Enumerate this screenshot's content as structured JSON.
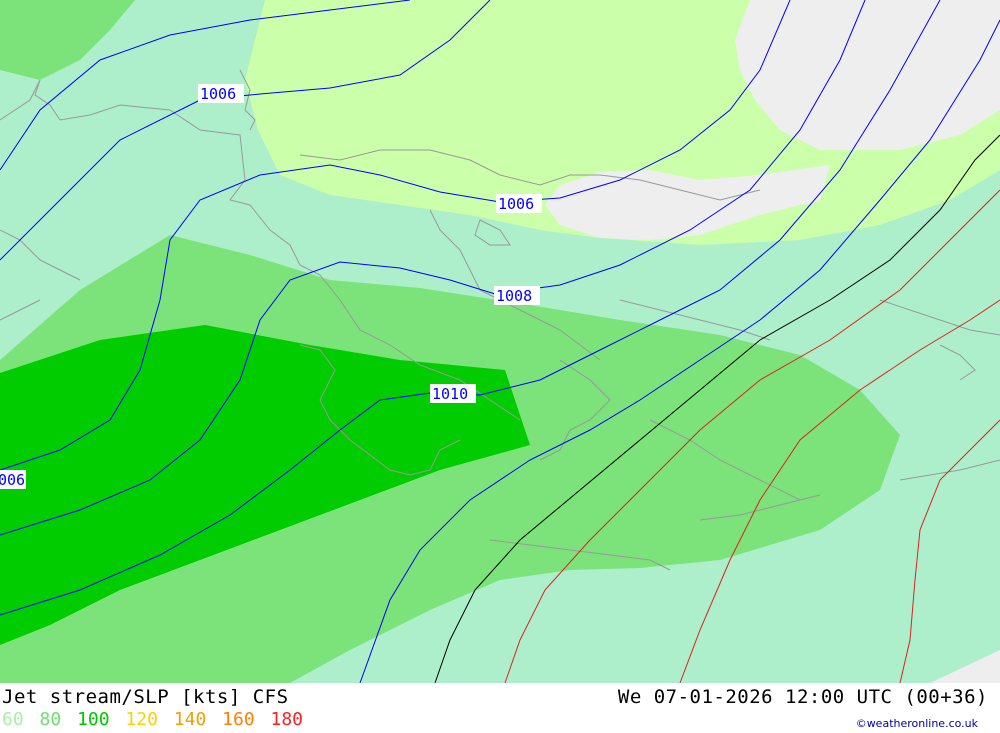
{
  "map": {
    "isobar_labels": [
      {
        "key": "iso1",
        "text": "1006"
      },
      {
        "key": "iso2",
        "text": "1006"
      },
      {
        "key": "iso3",
        "text": "1008"
      },
      {
        "key": "iso4",
        "text": "1010"
      },
      {
        "key": "iso5",
        "text": "006"
      }
    ]
  },
  "footer": {
    "title": "Jet stream/SLP [kts] CFS",
    "datetime": "We 07-01-2026 12:00 UTC (00+36)",
    "credit": "©weatheronline.co.uk",
    "legend": [
      {
        "value": "60",
        "color": "#a8f0a8"
      },
      {
        "value": "80",
        "color": "#6ee06e"
      },
      {
        "value": "100",
        "color": "#00c800"
      },
      {
        "value": "120",
        "color": "#ffd000"
      },
      {
        "value": "140",
        "color": "#f0a000"
      },
      {
        "value": "160",
        "color": "#ff8000"
      },
      {
        "value": "180",
        "color": "#ff2020"
      }
    ]
  },
  "colors": {
    "land_light": "#ccffaa",
    "sea_gray": "#eeeeee",
    "jet_60": "#adefcb",
    "jet_80": "#7ce37a",
    "jet_100": "#00cc00",
    "isobar": "#0000ff",
    "coast": "#999999"
  }
}
